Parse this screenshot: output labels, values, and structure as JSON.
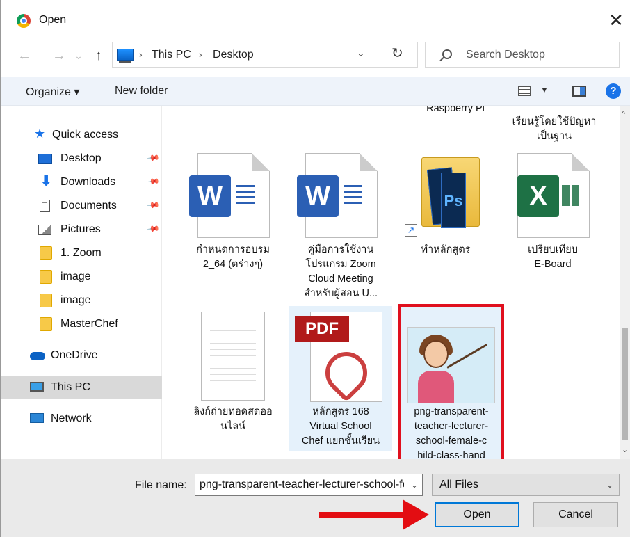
{
  "window": {
    "title": "Open",
    "close_label": "✕"
  },
  "nav": {
    "back": "←",
    "forward": "→",
    "recent": "⌄",
    "up": "↑",
    "breadcrumb": [
      "This PC",
      "Desktop"
    ],
    "separator": "›",
    "refresh": "↻",
    "search_placeholder": "Search Desktop"
  },
  "toolbar": {
    "organize": "Organize ▾",
    "new_folder": "New folder",
    "help": "?"
  },
  "sidebar": {
    "items": [
      {
        "label": "Quick access",
        "icon": "star-icon"
      },
      {
        "label": "Desktop",
        "icon": "desktop-icon",
        "pinned": true
      },
      {
        "label": "Downloads",
        "icon": "downloads-icon",
        "pinned": true
      },
      {
        "label": "Documents",
        "icon": "documents-icon",
        "pinned": true
      },
      {
        "label": "Pictures",
        "icon": "pictures-icon",
        "pinned": true
      },
      {
        "label": "1. Zoom",
        "icon": "folder-icon"
      },
      {
        "label": "image",
        "icon": "folder-icon"
      },
      {
        "label": "image",
        "icon": "folder-icon"
      },
      {
        "label": "MasterChef",
        "icon": "folder-icon"
      },
      {
        "label": "OneDrive",
        "icon": "cloud-icon"
      },
      {
        "label": "This PC",
        "icon": "pc-icon",
        "selected": true
      },
      {
        "label": "Network",
        "icon": "network-icon"
      }
    ]
  },
  "files": {
    "partial_top": [
      "Raspberry Pi",
      "เรียนรู้โดยใช้ปัญหา",
      "เป็นฐาน"
    ],
    "row1": [
      {
        "lines": [
          "กำหนดการอบรม",
          "2_64 (ตร่างๆ)"
        ],
        "type": "word",
        "glyph": "W"
      },
      {
        "lines": [
          "คู่มือการใช้งาน",
          "โปรแกรม Zoom",
          "Cloud Meeting",
          "สำหรับผู้สอน U..."
        ],
        "type": "word",
        "glyph": "W"
      },
      {
        "lines": [
          "ทำหลักสูตร"
        ],
        "type": "folder-shortcut",
        "glyph": "Ps"
      },
      {
        "lines": [
          "เปรียบเทียบ",
          "E-Board"
        ],
        "type": "excel",
        "glyph": "X"
      }
    ],
    "row2": [
      {
        "lines": [
          "ลิงก์ถ่ายทอดสดออ",
          "นไลน์"
        ],
        "type": "text"
      },
      {
        "lines": [
          "หลักสูตร 168",
          "Virtual School",
          "Chef แยกชั้นเรียน"
        ],
        "type": "pdf",
        "glyph": "PDF"
      },
      {
        "lines": [
          "png-transparent-",
          "teacher-lecturer-",
          "school-female-c",
          "hild-class-hand"
        ],
        "type": "image",
        "selected": true
      }
    ]
  },
  "footer": {
    "filename_label": "File name:",
    "filename_value": "png-transparent-teacher-lecturer-school-female-child-class-hand",
    "filetype_value": "All Files",
    "open_label": "Open",
    "cancel_label": "Cancel"
  },
  "colors": {
    "accent": "#0078d7",
    "highlight_box": "#e0101e",
    "arrow": "#e30d12",
    "selection_bg": "#e5f1fb"
  }
}
